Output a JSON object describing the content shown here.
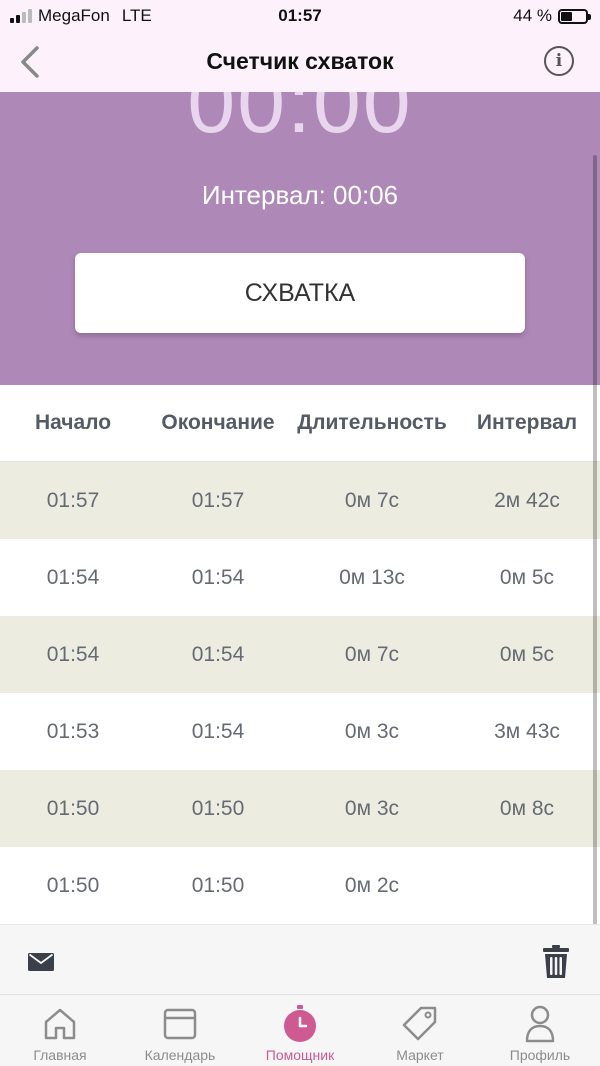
{
  "status_bar": {
    "carrier": "MegaFon",
    "network": "LTE",
    "time": "01:57",
    "battery": "44 %",
    "battery_level": 0.44
  },
  "nav": {
    "title": "Счетчик схваток"
  },
  "hero": {
    "timer": "00:00",
    "interval_text": "Интервал: 00:06",
    "button_label": "СХВАТКА"
  },
  "table": {
    "headers": [
      "Начало",
      "Окончание",
      "Длительность",
      "Интервал"
    ],
    "rows": [
      {
        "start": "01:57",
        "end": "01:57",
        "duration": "0м 7с",
        "interval": "2м 42с"
      },
      {
        "start": "01:54",
        "end": "01:54",
        "duration": "0м 13с",
        "interval": "0м 5с"
      },
      {
        "start": "01:54",
        "end": "01:54",
        "duration": "0м 7с",
        "interval": "0м 5с"
      },
      {
        "start": "01:53",
        "end": "01:54",
        "duration": "0м 3с",
        "interval": "3м 43с"
      },
      {
        "start": "01:50",
        "end": "01:50",
        "duration": "0м 3с",
        "interval": "0м 8с"
      },
      {
        "start": "01:50",
        "end": "01:50",
        "duration": "0м 2с",
        "interval": ""
      }
    ]
  },
  "actions": {
    "mail_icon": "mail-icon",
    "trash_icon": "trash-icon"
  },
  "tabs": [
    {
      "label": "Главная",
      "icon": "home-icon"
    },
    {
      "label": "Календарь",
      "icon": "calendar-icon"
    },
    {
      "label": "Помощник",
      "icon": "stopwatch-icon",
      "active": true
    },
    {
      "label": "Маркет",
      "icon": "tag-icon"
    },
    {
      "label": "Профиль",
      "icon": "profile-icon"
    }
  ],
  "colors": {
    "accent": "#cf5a92",
    "hero_bg": "#ae89b8",
    "row_alt": "#ecede0",
    "nav_bg": "#fdf2fb"
  }
}
